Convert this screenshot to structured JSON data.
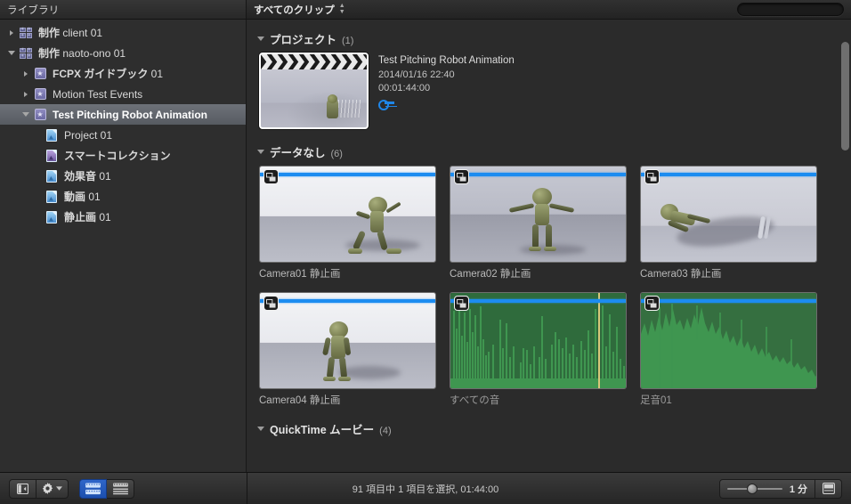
{
  "topbar": {
    "library_title": "ライブラリ",
    "clip_filter_label": "すべてのクリップ",
    "search_placeholder": "",
    "search_value": "",
    "search_icon": "search-icon",
    "stepper_icon": "updown-stepper-icon"
  },
  "sidebar": {
    "items": [
      {
        "label_bold": "制作",
        "label_thin": " client 01",
        "icon": "library-icon",
        "indent": 0,
        "disclosure": "collapsed",
        "selected": false
      },
      {
        "label_bold": "制作",
        "label_thin": " naoto-ono 01",
        "icon": "library-icon",
        "indent": 0,
        "disclosure": "expanded",
        "selected": false
      },
      {
        "label_bold": "FCPX ガイドブック",
        "label_thin": " 01",
        "icon": "event-icon",
        "indent": 1,
        "disclosure": "collapsed",
        "selected": false
      },
      {
        "label_bold": "",
        "label_thin": "Motion Test Events",
        "icon": "event-icon",
        "indent": 1,
        "disclosure": "collapsed",
        "selected": false
      },
      {
        "label_bold": "Test Pitching Robot Animation",
        "label_thin": "",
        "icon": "event-icon",
        "indent": 1,
        "disclosure": "expanded",
        "selected": true
      },
      {
        "label_bold": "",
        "label_thin": "Project 01",
        "icon": "document-icon",
        "indent": 2,
        "disclosure": "none",
        "selected": false
      },
      {
        "label_bold": "スマートコレクション",
        "label_thin": "",
        "icon": "smart-collection-icon",
        "indent": 2,
        "disclosure": "none",
        "selected": false
      },
      {
        "label_bold": "効果音",
        "label_thin": " 01",
        "icon": "document-icon",
        "indent": 2,
        "disclosure": "none",
        "selected": false
      },
      {
        "label_bold": "動画",
        "label_thin": " 01",
        "icon": "document-icon",
        "indent": 2,
        "disclosure": "none",
        "selected": false
      },
      {
        "label_bold": "静止画",
        "label_thin": " 01",
        "icon": "document-icon",
        "indent": 2,
        "disclosure": "none",
        "selected": false
      }
    ]
  },
  "browser": {
    "sections": [
      {
        "title": "プロジェクト",
        "count": "(1)"
      },
      {
        "title": "データなし",
        "count": "(6)"
      },
      {
        "title": "QuickTime ムービー",
        "count": "(4)"
      }
    ],
    "project": {
      "name": "Test Pitching Robot Animation",
      "date": "2014/01/16 22:40",
      "duration": "00:01:44:00",
      "badge_icon": "key-icon",
      "thumb_icon": "clapperboard-icon"
    },
    "clips": [
      {
        "label": "Camera01 静止画",
        "kind": "video",
        "scene": "studio",
        "badge_icon": "stabilization-icon"
      },
      {
        "label": "Camera02 静止画",
        "kind": "video",
        "scene": "studio2",
        "badge_icon": "stabilization-icon"
      },
      {
        "label": "Camera03 静止画",
        "kind": "video",
        "scene": "studio3",
        "badge_icon": "stabilization-icon"
      },
      {
        "label": "Camera04 静止画",
        "kind": "video",
        "scene": "studio",
        "badge_icon": "stabilization-icon"
      },
      {
        "label": "すべての音",
        "kind": "audio",
        "scene": "wave-spiky",
        "badge_icon": "stabilization-icon"
      },
      {
        "label": "足音01",
        "kind": "audio",
        "scene": "wave-decay",
        "badge_icon": "stabilization-icon"
      }
    ]
  },
  "bottombar": {
    "sidebar_toggle_icon": "sidebar-toggle-icon",
    "gear_icon": "gear-icon",
    "gear_chevron_icon": "chevron-down-icon",
    "filmstrip_view_icon": "filmstrip-view-icon",
    "list_view_icon": "list-view-icon",
    "status": "91 項目中 1 項目を選択, 01:44:00",
    "status_parts": {
      "total": "91",
      "mid": "項目中",
      "selected": "1",
      "suffix": "項目を選択,",
      "time": "01:44:00"
    },
    "zoom_label": "1 分",
    "zoom_number": "1",
    "zoom_unit": "分",
    "appearance_icon": "clip-appearance-icon"
  },
  "colors": {
    "accent_blue": "#1c8cf0",
    "selection_gray": "#6e7279",
    "audio_green": "#2f6b3c",
    "active_button_blue": "#2f66c9"
  }
}
